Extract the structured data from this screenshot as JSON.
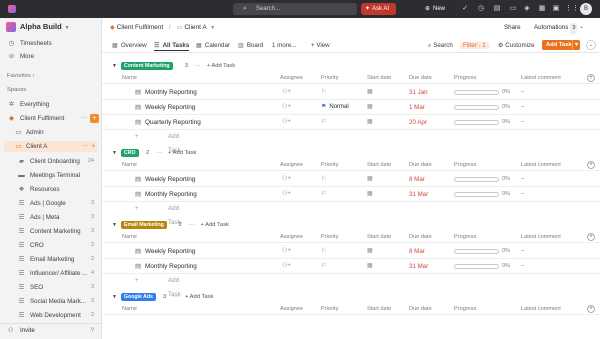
{
  "topbar": {
    "search_label": "Search...",
    "ask_ai_label": "Ask AI",
    "new_label": "New",
    "avatar_initial": "B"
  },
  "sidebar": {
    "workspace": "Alpha Build",
    "top_items": [
      {
        "label": "Timesheets",
        "icon": "clock-icon"
      },
      {
        "label": "More",
        "icon": "more-icon"
      }
    ],
    "favorites_label": "Favorites",
    "spaces_label": "Spaces",
    "everything_label": "Everything",
    "client_space_label": "Client Fulfilment",
    "admin_label": "Admin",
    "client_a_label": "Client A",
    "lists": [
      {
        "label": "Client Onboarding",
        "count": "24"
      },
      {
        "label": "Meetings Terminal",
        "count": ""
      },
      {
        "label": "Resources",
        "count": ""
      },
      {
        "label": "Ads | Google",
        "count": "3"
      },
      {
        "label": "Ads | Meta",
        "count": "3"
      },
      {
        "label": "Content Marketing",
        "count": "3"
      },
      {
        "label": "CRO",
        "count": "2"
      },
      {
        "label": "Email Marketing",
        "count": "2"
      },
      {
        "label": "Influencer/ Affiliate ...",
        "count": "4"
      },
      {
        "label": "SEO",
        "count": "3"
      },
      {
        "label": "Social Media Mark...",
        "count": "3"
      },
      {
        "label": "Web Development",
        "count": "2"
      }
    ],
    "invite_label": "Invite"
  },
  "header": {
    "breadcrumb_1": "Client Fulfilment",
    "breadcrumb_sep": "/",
    "breadcrumb_2": "Client A",
    "share_label": "Share",
    "automations_label": "Automations",
    "automations_count": "3"
  },
  "tabs": {
    "overview": "Overview",
    "all_tasks": "All Tasks",
    "calendar": "Calendar",
    "board": "Board",
    "more": "1 more...",
    "view": "+ View",
    "search": "Search",
    "filter": "Filter · 1",
    "customize": "Customize",
    "add_task": "Add Task"
  },
  "columns": {
    "name": "Name",
    "assignee": "Assignee",
    "priority": "Priority",
    "start_date": "Start date",
    "due_date": "Due date",
    "progress": "Progress",
    "latest_comment": "Latest comment"
  },
  "add_task_label": "Add Task",
  "add_task_inline": "+ Add Task",
  "groups": [
    {
      "name": "Content Marketing",
      "color": "#1fa36b",
      "count": "3",
      "tasks": [
        {
          "name": "Monthly Reporting",
          "priority": "",
          "due": "31 Jan",
          "progress": "0%",
          "comment": "–"
        },
        {
          "name": "Weekly Reporting",
          "priority": "Normal",
          "due": "1 Mar",
          "progress": "0%",
          "comment": "–"
        },
        {
          "name": "Quarterly Reporting",
          "priority": "",
          "due": "20 Apr",
          "progress": "0%",
          "comment": "–"
        }
      ]
    },
    {
      "name": "CRO",
      "color": "#1fa36b",
      "count": "2",
      "tasks": [
        {
          "name": "Weekly Reporting",
          "priority": "",
          "due": "8 Mar",
          "progress": "0%",
          "comment": "–"
        },
        {
          "name": "Monthly Reporting",
          "priority": "",
          "due": "31 Mar",
          "progress": "0%",
          "comment": "–"
        }
      ]
    },
    {
      "name": "Email Marketing",
      "color": "#b8860b",
      "count": "2",
      "tasks": [
        {
          "name": "Weekly Reporting",
          "priority": "",
          "due": "8 Mar",
          "progress": "0%",
          "comment": "–"
        },
        {
          "name": "Monthly Reporting",
          "priority": "",
          "due": "31 Mar",
          "progress": "0%",
          "comment": "–"
        }
      ]
    },
    {
      "name": "Google Ads",
      "color": "#2f80ed",
      "count": "3",
      "tasks": []
    }
  ]
}
